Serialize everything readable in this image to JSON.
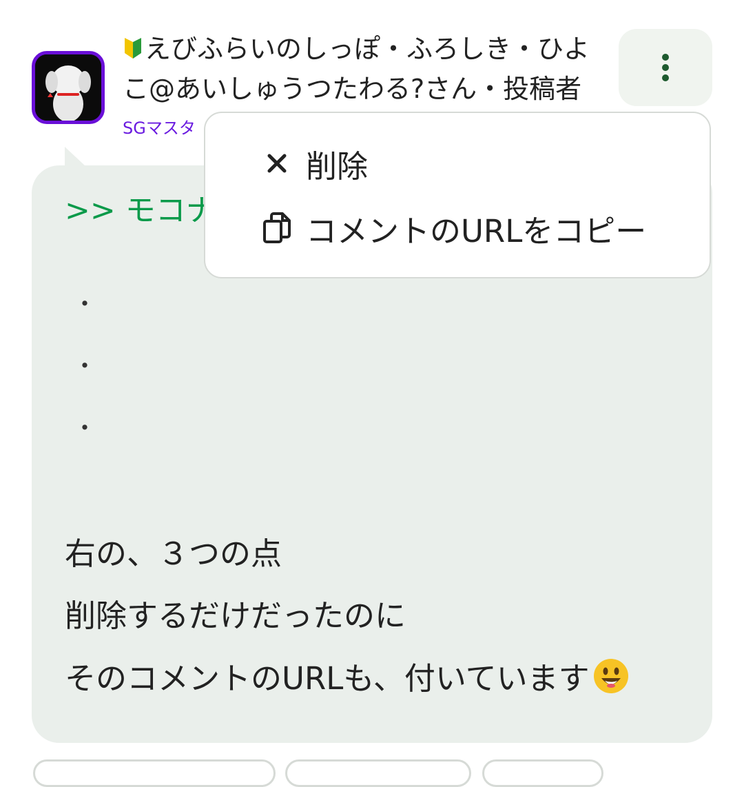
{
  "comment": {
    "author_name_line1": "えびふらいのしっぽ・ふろしき・ひよ",
    "author_name_line2": "こ@あいしゅうつたわる?さん・投稿者",
    "author_sub": "SGマスタ",
    "reply_to": ">> モコナ",
    "dots": [
      "・",
      "・",
      "・"
    ],
    "message_lines": [
      "右の、３つの点",
      "削除するだけだったのに",
      "そのコメントのURLも、付いています"
    ]
  },
  "menu": {
    "items": [
      {
        "label": "削除",
        "icon": "close-icon"
      },
      {
        "label": "コメントのURLをコピー",
        "icon": "copy-icon"
      }
    ]
  },
  "colors": {
    "accent_purple": "#6a0fd8",
    "reply_green": "#0a9a4a",
    "bubble_bg": "#eaefeb",
    "more_dots": "#1d5a2e"
  }
}
